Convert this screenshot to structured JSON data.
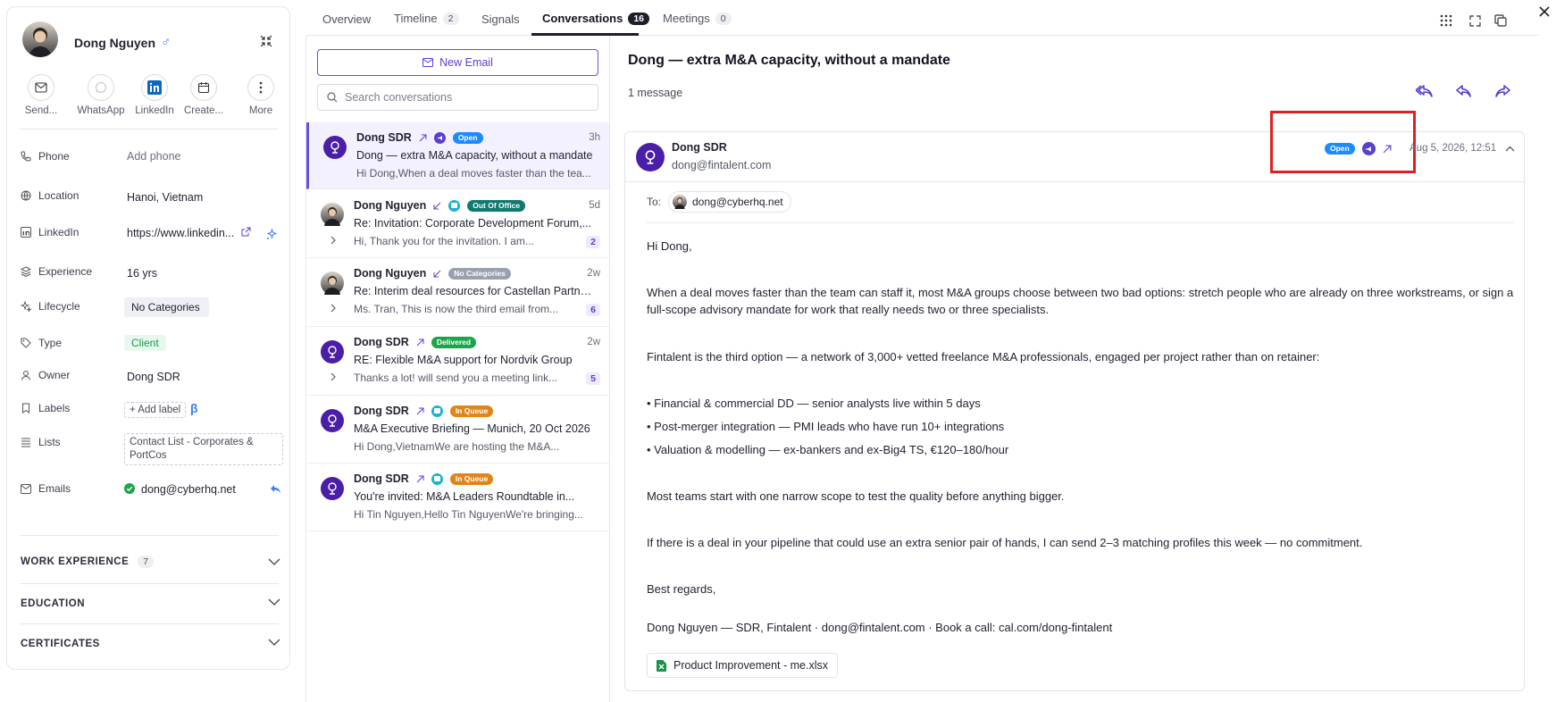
{
  "profile": {
    "name": "Dong Nguyen",
    "gender_symbol": "♂",
    "actions": [
      {
        "label": "Send..."
      },
      {
        "label": "WhatsApp"
      },
      {
        "label": "LinkedIn"
      },
      {
        "label": "Create..."
      },
      {
        "label": "More"
      }
    ],
    "fields": {
      "phone_label": "Phone",
      "phone_value": "Add phone",
      "location_label": "Location",
      "location_value": "Hanoi, Vietnam",
      "linkedin_label": "LinkedIn",
      "linkedin_value": "https://www.linkedin...",
      "experience_label": "Experience",
      "experience_value": "16 yrs",
      "lifecycle_label": "Lifecycle",
      "lifecycle_value": "No Categories",
      "type_label": "Type",
      "type_value": "Client",
      "owner_label": "Owner",
      "owner_value": "Dong SDR",
      "labels_label": "Labels",
      "labels_add": "+ Add label",
      "labels_beta": "β",
      "lists_label": "Lists",
      "lists_value": "Contact List - Corporates & PortCos",
      "emails_label": "Emails",
      "emails_value": "dong@cyberhq.net"
    },
    "sections": {
      "work_experience": "WORK EXPERIENCE",
      "work_count": "7",
      "education": "EDUCATION",
      "certificates": "CERTIFICATES"
    }
  },
  "tabs": [
    {
      "label": "Overview"
    },
    {
      "label": "Timeline",
      "count": "2"
    },
    {
      "label": "Signals"
    },
    {
      "label": "Conversations",
      "count": "16"
    },
    {
      "label": "Meetings",
      "count": "0"
    }
  ],
  "list": {
    "new_email": "New Email",
    "search_placeholder": "Search conversations",
    "items": [
      {
        "name": "Dong SDR",
        "badge": "Open",
        "time": "3h",
        "subject": "Dong — extra M&A capacity, without a mandate",
        "preview": "Hi Dong,When a deal moves faster than the tea..."
      },
      {
        "name": "Dong Nguyen",
        "badge": "Out Of Office",
        "time": "5d",
        "subject": "Re: Invitation: Corporate Development Forum,...",
        "preview": "Hi, Thank you for the invitation. I am...",
        "count": "2"
      },
      {
        "name": "Dong Nguyen",
        "badge": "No Categories",
        "time": "2w",
        "subject": "Re: Interim deal resources for Castellan Partners",
        "preview": "Ms. Tran, This is now the third email from...",
        "count": "6"
      },
      {
        "name": "Dong SDR",
        "badge": "Delivered",
        "time": "2w",
        "subject": "RE: Flexible M&A support for Nordvik Group",
        "preview": "Thanks a lot! will send you a meeting link...",
        "count": "5"
      },
      {
        "name": "Dong SDR",
        "badge": "In Queue",
        "time": "",
        "subject": "M&A Executive Briefing — Munich, 20 Oct 2026",
        "preview": "Hi Dong,VietnamWe are hosting the M&A..."
      },
      {
        "name": "Dong SDR",
        "badge": "In Queue",
        "time": "",
        "subject": "You're invited: M&A Leaders Roundtable in...",
        "preview": "Hi Tin Nguyen,Hello Tin NguyenWe're bringing..."
      }
    ]
  },
  "detail": {
    "title": "Dong — extra M&A capacity, without a mandate",
    "message_count": "1 message",
    "sender_name": "Dong SDR",
    "sender_email": "dong@fintalent.com",
    "status_badge": "Open",
    "date": "Aug 5, 2026, 12:51",
    "to_label": "To:",
    "to_email": "dong@cyberhq.net",
    "body": {
      "greeting": "Hi Dong,",
      "p1a": "When a deal moves faster than the team can staff it, most M&A groups choose between two bad options: stretch people who are already on three workstreams, or sign a",
      "p1b": "full-scope advisory mandate for work that really needs two or three specialists.",
      "p2": "Fintalent is the third option — a network of 3,000+ vetted freelance M&A professionals, engaged per project rather than on retainer:",
      "b1": "• Financial & commercial DD — senior analysts live within 5 days",
      "b2": "• Post-merger integration — PMI leads who have run 10+ integrations",
      "b3": "• Valuation & modelling — ex-bankers and ex-Big4 TS, €120–180/hour",
      "p3": "Most teams start with one narrow scope to test the quality before anything bigger.",
      "p4": "If there is a deal in your pipeline that could use an extra senior pair of hands, I can send 2–3 matching profiles this week — no commitment.",
      "signoff": "Best regards,",
      "signature": "Dong Nguyen — SDR, Fintalent · dong@fintalent.com · Book a call: cal.com/dong-fintalent"
    },
    "attachment": "Product Improvement - me.xlsx"
  },
  "colors": {
    "accent": "#5b3fd0",
    "open": "#1a8cff",
    "out_of_office": "#0f7a6e",
    "no_categories": "#9aa0ad",
    "delivered": "#1aa64a",
    "in_queue": "#e0851a",
    "highlight": "#e02020"
  }
}
